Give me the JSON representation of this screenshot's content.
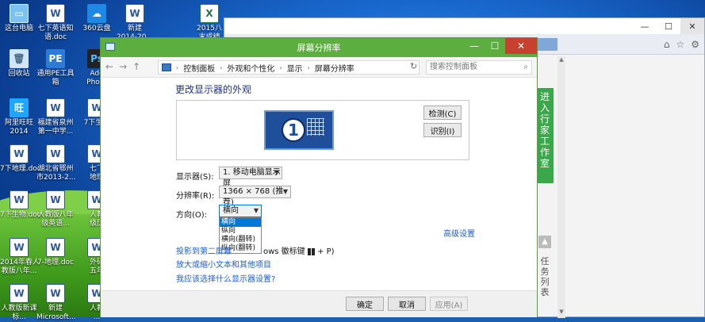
{
  "desktop": {
    "icons": [
      {
        "label": "这台电脑",
        "glyph": "▭",
        "kind": "pc"
      },
      {
        "label": "七下英语知\n语.doc",
        "glyph": "W",
        "kind": "word"
      },
      {
        "label": "360云盘",
        "glyph": "☁",
        "kind": "cloud"
      },
      {
        "label": "新建\n2014-20...",
        "glyph": "W",
        "kind": "word"
      },
      {
        "label": "2015八\n末成绩",
        "glyph": "X",
        "kind": "excel"
      },
      {
        "label": "回收站",
        "glyph": "🗑",
        "kind": "trash"
      },
      {
        "label": "通用PE工具\n箱",
        "glyph": "PE",
        "kind": "pe"
      },
      {
        "label": "Ado\nPhoto",
        "glyph": "Ps",
        "kind": "ado"
      },
      {
        "label": "阿里旺旺\n2014",
        "glyph": "旺",
        "kind": "ww"
      },
      {
        "label": "福建省泉州\n第一中学...",
        "glyph": "W",
        "kind": "word"
      },
      {
        "label": "7下生物",
        "glyph": "W",
        "kind": "word"
      },
      {
        "label": "7下地理.doc",
        "glyph": "W",
        "kind": "word"
      },
      {
        "label": "湖北省鄂州\n市2013-2...",
        "glyph": "W",
        "kind": "word"
      },
      {
        "label": "七下\n地理",
        "glyph": "W",
        "kind": "word"
      },
      {
        "label": "7下生物.doc",
        "glyph": "W",
        "kind": "word"
      },
      {
        "label": "人教版八年\n级英语...",
        "glyph": "W",
        "kind": "word"
      },
      {
        "label": "人教\n级历",
        "glyph": "W",
        "kind": "word"
      },
      {
        "label": "2014年春人\n教版八年...",
        "glyph": "W",
        "kind": "word"
      },
      {
        "label": "7-地理.doc",
        "glyph": "W",
        "kind": "word"
      },
      {
        "label": "外研\n五年",
        "glyph": "W",
        "kind": "word"
      },
      {
        "label": "人教版新课\n标...",
        "glyph": "W",
        "kind": "word"
      },
      {
        "label": "新建\nMicrosoft...",
        "glyph": "W",
        "kind": "word"
      },
      {
        "label": "人教\n...",
        "glyph": "W",
        "kind": "word"
      }
    ]
  },
  "browser": {
    "tools": [
      "⌂",
      "☆",
      "⚙"
    ],
    "side_banner": "进\n入\n行\n家\n工\n作\n室",
    "side_tasks": "任\n务\n列\n表",
    "caption": {
      "min": "—",
      "max": "☐",
      "close": "✕"
    }
  },
  "window": {
    "title": "屏幕分辨率",
    "controls": {
      "min": "—",
      "max": "☐",
      "close": "✕"
    },
    "nav": {
      "back": "←",
      "forward": "→",
      "up": "↑"
    },
    "breadcrumbs": [
      "控制面板",
      "外观和个性化",
      "显示",
      "屏幕分辨率"
    ],
    "search_placeholder": "搜索控制面板",
    "heading": "更改显示器的外观",
    "monitor_number": "1",
    "detect_label": "检测(C)",
    "identify_label": "识别(I)",
    "display_label": "显示器(S):",
    "display_value": "1. 移动电脑显示屏",
    "resolution_label": "分辨率(R):",
    "resolution_value": "1366 × 768 (推荐)",
    "orientation_label": "方向(O):",
    "orientation_value": "横向",
    "orientation_options": [
      "横向",
      "纵向",
      "横向(翻转)",
      "纵向(翻转)"
    ],
    "advanced_link": "高级设置",
    "project_link": "投影到第二屏幕",
    "project_suffix_a": "ows 徽标键",
    "project_suffix_b": "+ P)",
    "text_size_link": "放大或缩小文本和其他项目",
    "which_display_link": "我应该选择什么显示器设置?",
    "ok_label": "确定",
    "cancel_label": "取消",
    "apply_label": "应用(A)"
  }
}
